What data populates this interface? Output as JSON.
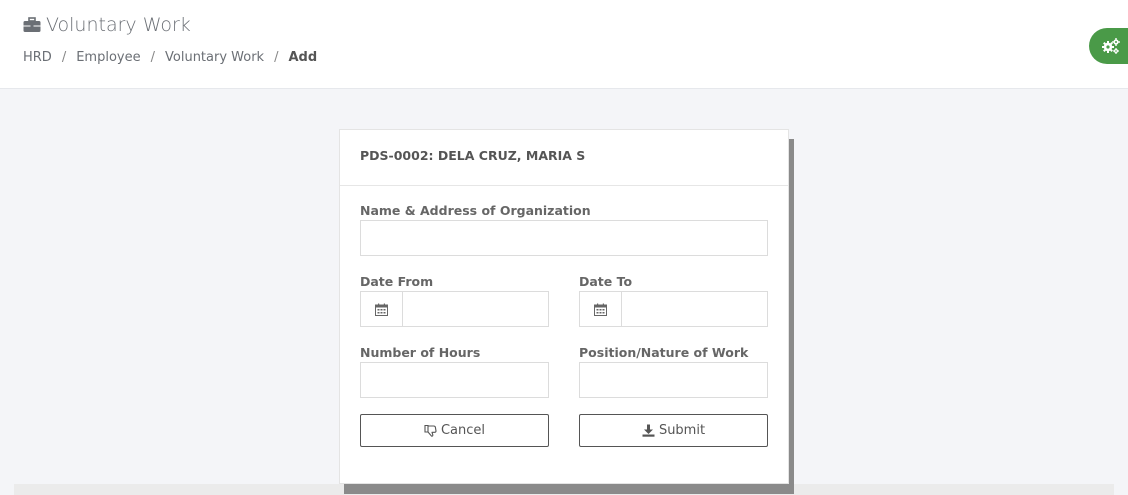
{
  "header": {
    "title": "Voluntary Work",
    "title_icon": "briefcase-icon",
    "breadcrumb": [
      "HRD",
      "Employee",
      "Voluntary Work",
      "Add"
    ],
    "settings_icon": "gears-icon",
    "settings_color": "#4a9a48"
  },
  "form": {
    "employee": "PDS-0002: DELA CRUZ, MARIA S",
    "fields": {
      "organization": {
        "label": "Name & Address of Organization",
        "value": ""
      },
      "date_from": {
        "label": "Date From",
        "value": "",
        "icon": "calendar-icon"
      },
      "date_to": {
        "label": "Date To",
        "value": "",
        "icon": "calendar-icon"
      },
      "hours": {
        "label": "Number of Hours",
        "value": ""
      },
      "position": {
        "label": "Position/Nature of Work",
        "value": ""
      }
    },
    "buttons": {
      "cancel": {
        "label": "Cancel",
        "icon": "thumbs-down-icon"
      },
      "submit": {
        "label": "Submit",
        "icon": "download-icon"
      }
    }
  }
}
